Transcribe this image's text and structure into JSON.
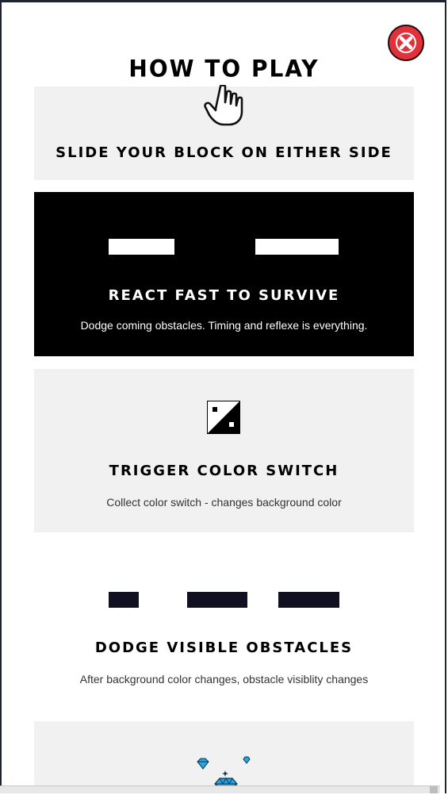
{
  "title": "HOW TO PLAY",
  "close_icon": "close-icon",
  "colors": {
    "close_red": "#e2313b",
    "card_grey": "#f1f1f1",
    "card_black": "#000000",
    "obstacle_dark": "#101020",
    "gem_blue": "#2ba3e0"
  },
  "cards": [
    {
      "icon": "hand-pointer-icon",
      "heading": "SLIDE YOUR BLOCK ON EITHER SIDE",
      "description": ""
    },
    {
      "icon": "white-bars",
      "heading": "REACT FAST TO SURVIVE",
      "description": "Dodge coming obstacles. Timing and reflexe is everything."
    },
    {
      "icon": "color-switch-icon",
      "heading": "TRIGGER COLOR SWITCH",
      "description": "Collect color switch - changes background color"
    },
    {
      "icon": "dark-bars",
      "heading": "DODGE VISIBLE OBSTACLES",
      "description": "After background color changes, obstacle visiblity changes"
    },
    {
      "icon": "diamond-icon",
      "heading": "",
      "description": ""
    }
  ]
}
